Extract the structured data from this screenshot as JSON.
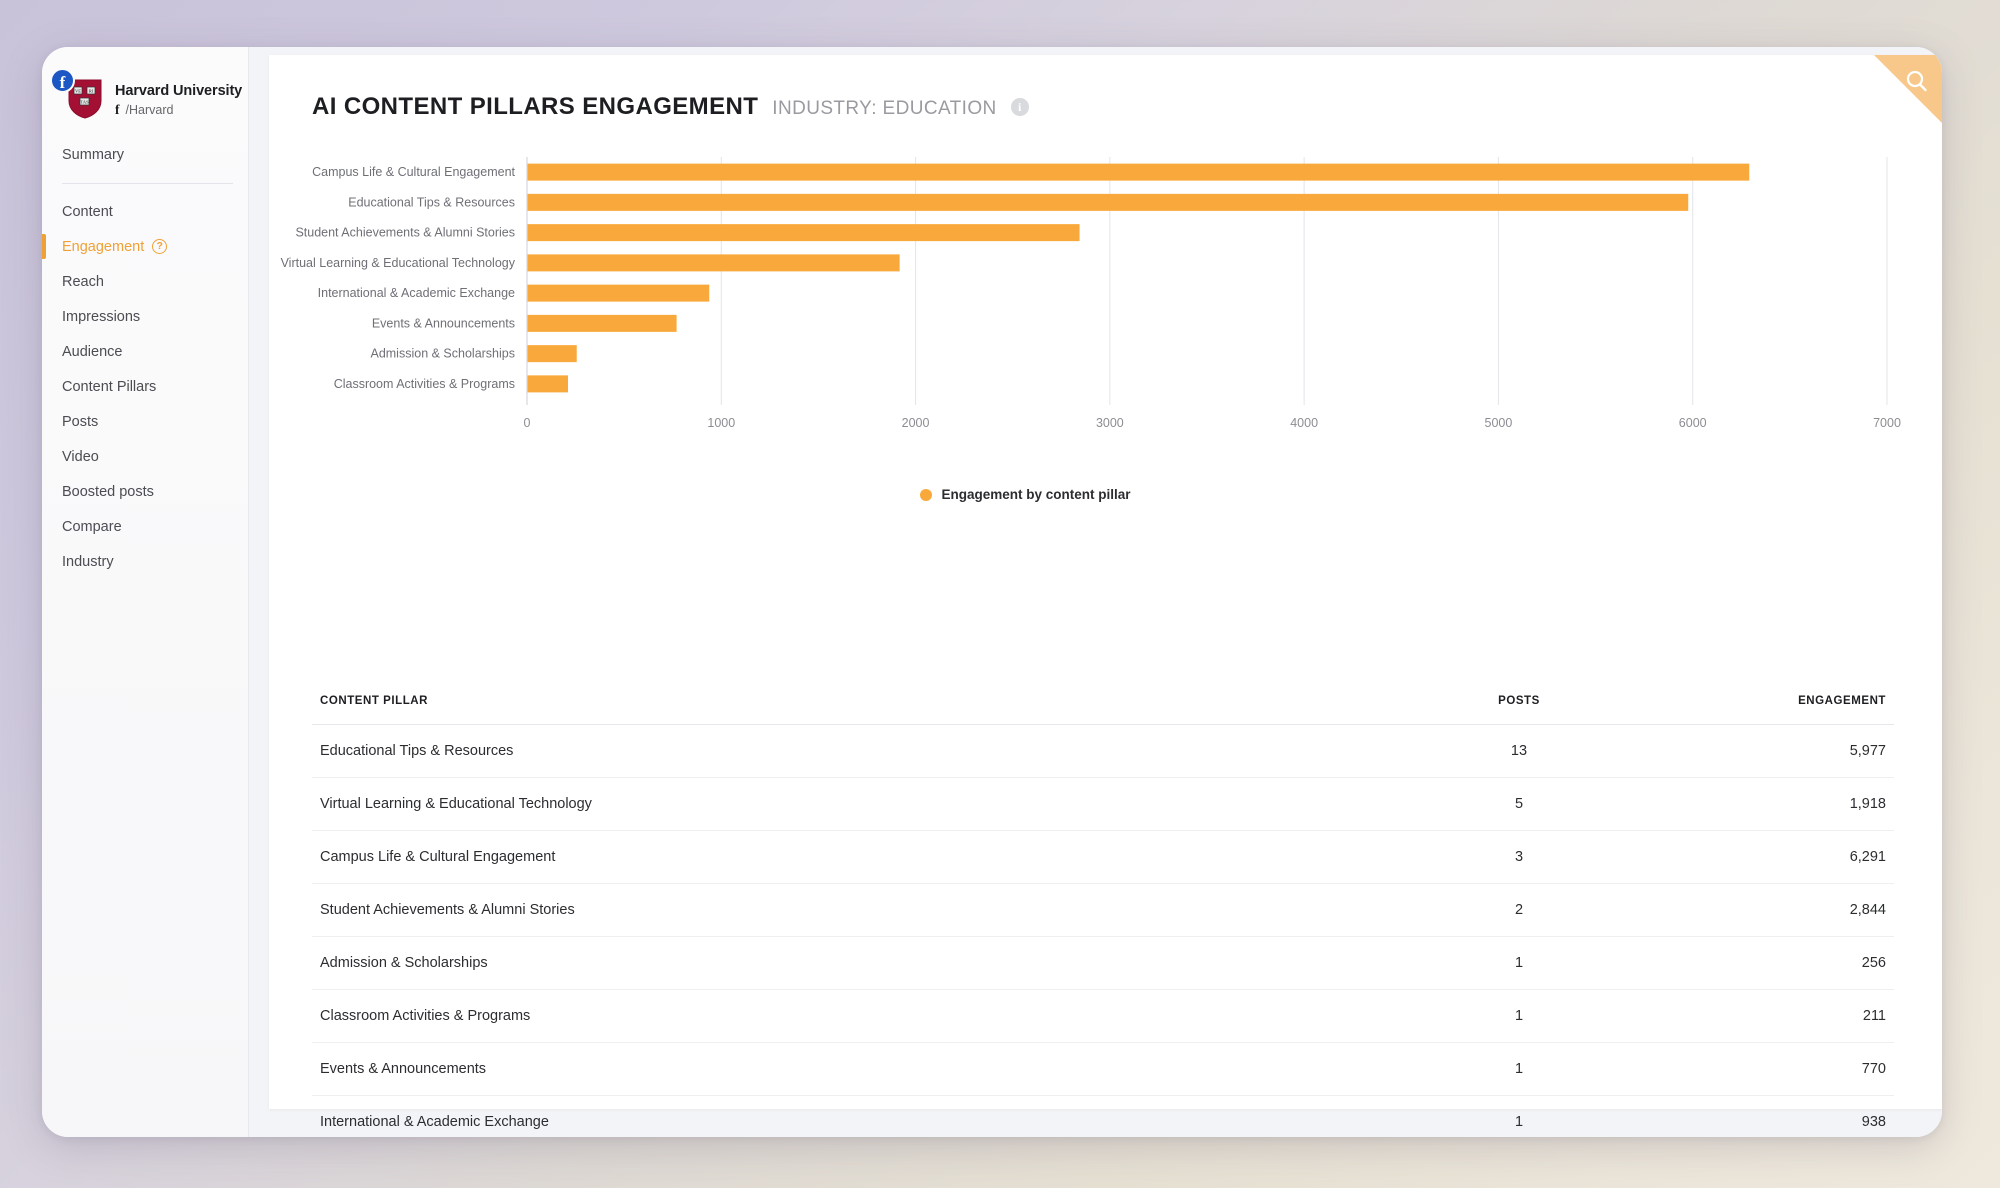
{
  "brand": {
    "name": "Harvard University",
    "handle": "/Harvard",
    "network_glyph": "f",
    "logo_icon": "harvard-shield-icon",
    "badge_icon": "facebook-badge-icon"
  },
  "sidebar": {
    "items": [
      {
        "label": "Summary",
        "active": false
      },
      {
        "label": "Content",
        "active": false
      },
      {
        "label": "Engagement",
        "active": true,
        "help": "?"
      },
      {
        "label": "Reach",
        "active": false
      },
      {
        "label": "Impressions",
        "active": false
      },
      {
        "label": "Audience",
        "active": false
      },
      {
        "label": "Content Pillars",
        "active": false
      },
      {
        "label": "Posts",
        "active": false
      },
      {
        "label": "Video",
        "active": false
      },
      {
        "label": "Boosted posts",
        "active": false
      },
      {
        "label": "Compare",
        "active": false
      },
      {
        "label": "Industry",
        "active": false
      }
    ]
  },
  "header": {
    "title": "AI CONTENT PILLARS ENGAGEMENT",
    "subtitle": "INDUSTRY: EDUCATION",
    "info_glyph": "i",
    "search_icon": "search-icon"
  },
  "colors": {
    "accent": "#f0a135",
    "bar": "#f9a93c",
    "page_bg_left": "#c9c3da",
    "page_bg_right": "#efe9dd"
  },
  "chart_data": {
    "type": "bar",
    "orientation": "horizontal",
    "title": "AI CONTENT PILLARS ENGAGEMENT",
    "subtitle": "INDUSTRY: EDUCATION",
    "xlabel": "",
    "ylabel": "",
    "xlim": [
      0,
      7000
    ],
    "xticks": [
      0,
      1000,
      2000,
      3000,
      4000,
      5000,
      6000,
      7000
    ],
    "xtick_labels": [
      "0",
      "1000",
      "2000",
      "3000",
      "4000",
      "5000",
      "6000",
      "7000"
    ],
    "grid": true,
    "legend": {
      "position": "bottom",
      "entries": [
        "Engagement by content pillar"
      ]
    },
    "series": [
      {
        "name": "Engagement by content pillar",
        "color": "#f9a93c"
      }
    ],
    "categories": [
      "Campus Life & Cultural Engagement",
      "Educational Tips & Resources",
      "Student Achievements & Alumni Stories",
      "Virtual Learning & Educational Technology",
      "International & Academic Exchange",
      "Events & Announcements",
      "Admission & Scholarships",
      "Classroom Activities & Programs"
    ],
    "values": [
      6291,
      5977,
      2844,
      1918,
      938,
      770,
      256,
      211
    ]
  },
  "table": {
    "columns": [
      "CONTENT PILLAR",
      "POSTS",
      "ENGAGEMENT"
    ],
    "rows": [
      {
        "pillar": "Educational Tips & Resources",
        "posts": "13",
        "engagement": "5,977"
      },
      {
        "pillar": "Virtual Learning & Educational Technology",
        "posts": "5",
        "engagement": "1,918"
      },
      {
        "pillar": "Campus Life & Cultural Engagement",
        "posts": "3",
        "engagement": "6,291"
      },
      {
        "pillar": "Student Achievements & Alumni Stories",
        "posts": "2",
        "engagement": "2,844"
      },
      {
        "pillar": "Admission & Scholarships",
        "posts": "1",
        "engagement": "256"
      },
      {
        "pillar": "Classroom Activities & Programs",
        "posts": "1",
        "engagement": "211"
      },
      {
        "pillar": "Events & Announcements",
        "posts": "1",
        "engagement": "770"
      },
      {
        "pillar": "International & Academic Exchange",
        "posts": "1",
        "engagement": "938"
      }
    ]
  }
}
